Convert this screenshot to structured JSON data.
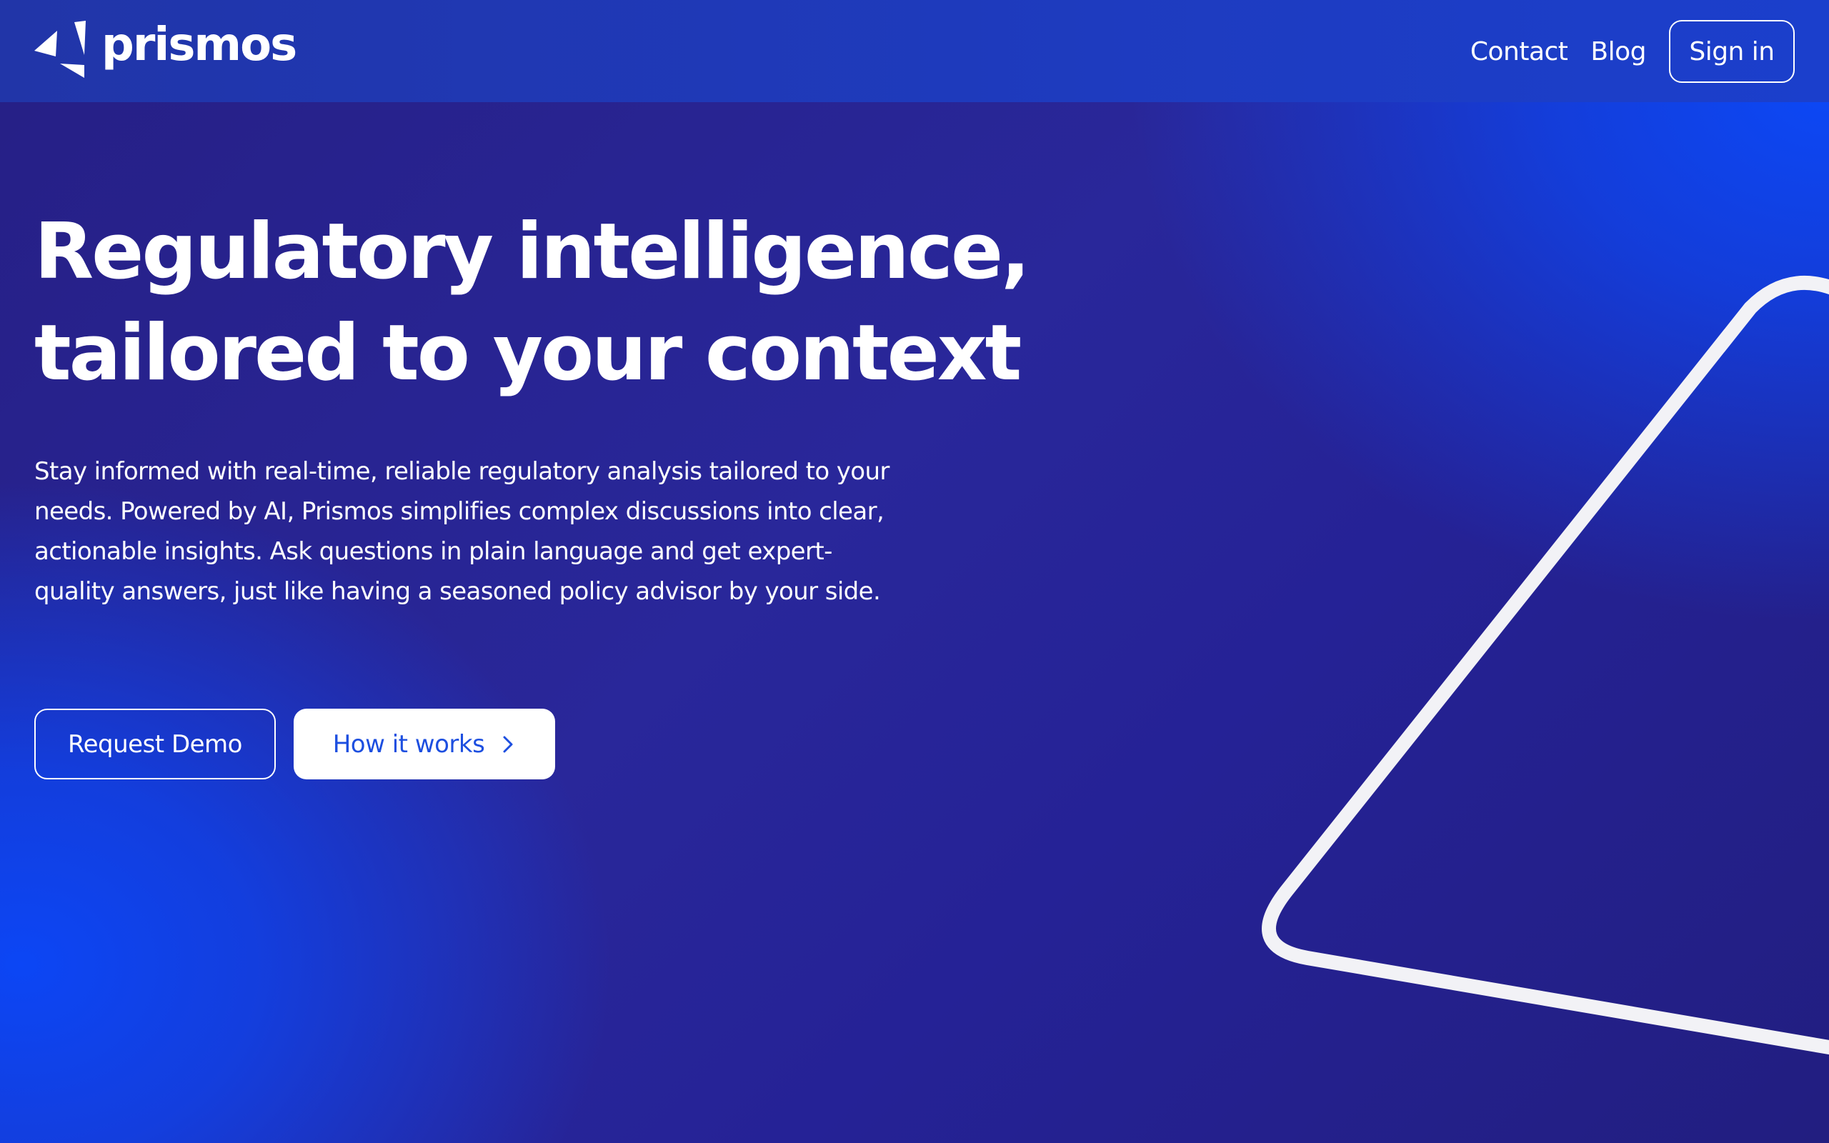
{
  "brand": {
    "name": "prismos",
    "logo_icon": "prism-shard-icon"
  },
  "nav": {
    "contact_label": "Contact",
    "blog_label": "Blog",
    "signin_label": "Sign in"
  },
  "hero": {
    "headline_line1": "Regulatory intelligence,",
    "headline_line2": "tailored to your context",
    "description": "Stay informed with real-time, reliable regulatory analysis tailored to your needs. Powered by AI, Prismos simplifies complex discussions into clear, actionable insights. Ask questions in plain language and get expert-quality answers, just like having a seasoned policy advisor by your side.",
    "primary_cta": "Request Demo",
    "secondary_cta": "How it works",
    "secondary_cta_icon": "chevron-right-icon"
  },
  "colors": {
    "accent_blue": "#0c46f5",
    "deep_indigo": "#261f85",
    "button_text_blue": "#1d4fe0",
    "white": "#ffffff"
  }
}
